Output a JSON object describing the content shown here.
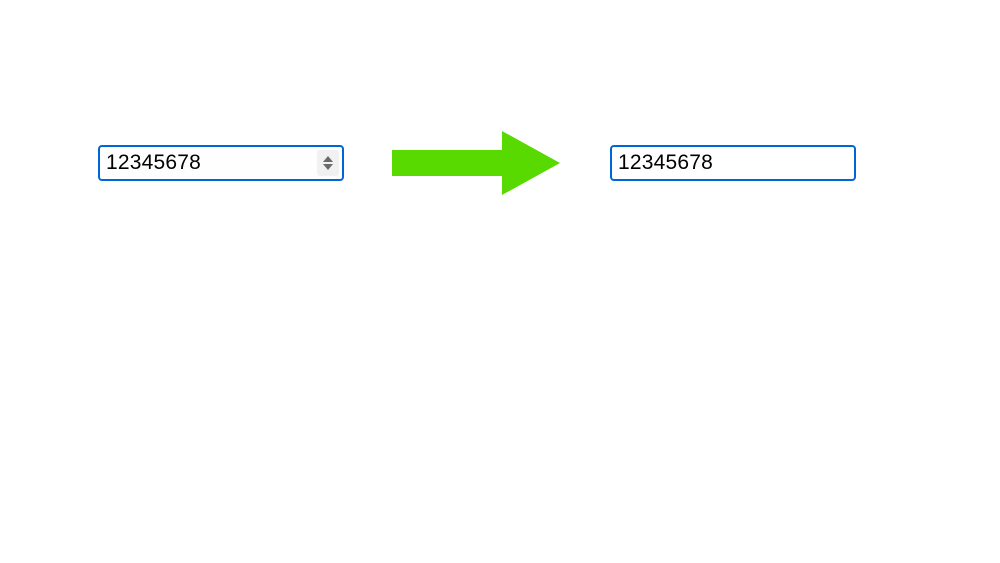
{
  "diagram": {
    "left_input_value": "12345678",
    "right_input_value": "12345678",
    "arrow_color": "#58d900",
    "border_color": "#0066d6"
  }
}
